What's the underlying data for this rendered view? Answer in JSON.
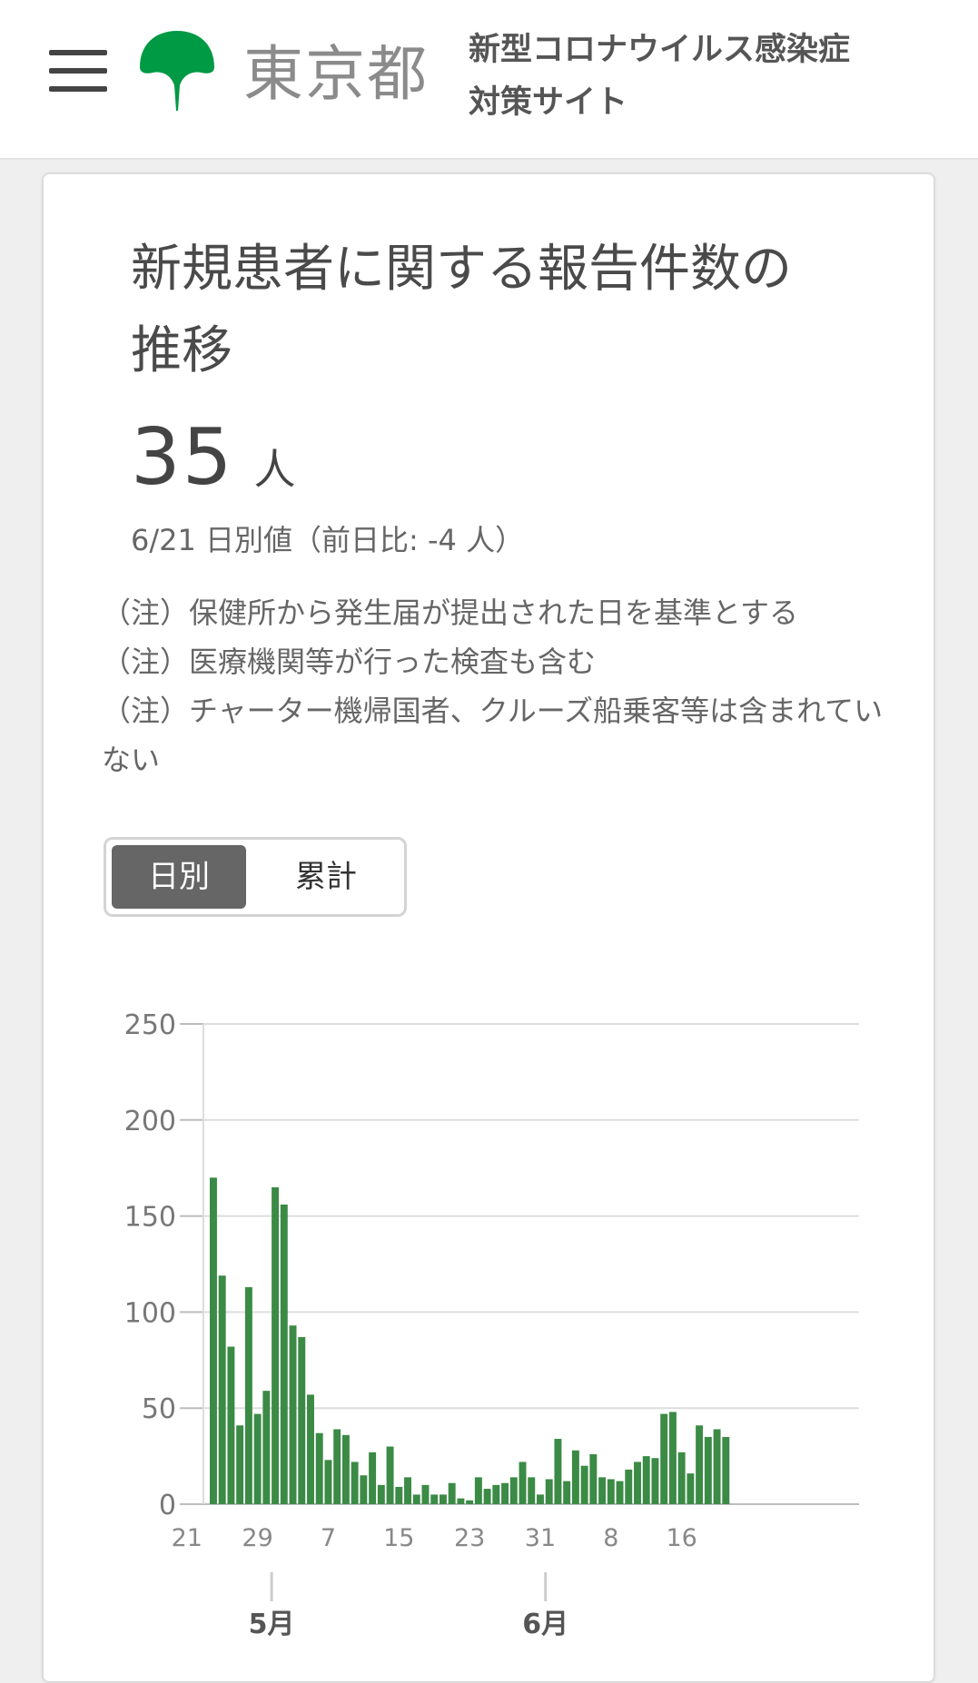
{
  "header": {
    "logo_text": "東京都",
    "site_title_line1": "新型コロナウイルス感染症",
    "site_title_line2": "対策サイト",
    "brand_color": "#009944"
  },
  "card": {
    "title_line1": "新規患者に関する報告件数の",
    "title_line2": "推移",
    "value": "35",
    "unit": "人",
    "subvalue": "6/21 日別値（前日比: -4 人）",
    "notes": [
      "（注）保健所から発生届が提出された日を基準とする",
      "（注）医療機関等が行った検査も含む",
      "（注）チャーター機帰国者、クルーズ船乗客等は含まれていない"
    ],
    "toggle": {
      "daily": "日別",
      "cumulative": "累計"
    }
  },
  "chart_data": {
    "type": "bar",
    "bar_color": "#3b8a45",
    "x_start": "2020-04-24",
    "x_end": "2020-06-21",
    "ylim": [
      0,
      250
    ],
    "y_ticks": [
      0,
      50,
      100,
      150,
      200,
      250
    ],
    "x_tick_labels": [
      "21",
      "29",
      "7",
      "15",
      "23",
      "31",
      "8",
      "16"
    ],
    "month_labels": [
      "5月",
      "6月"
    ],
    "values": [
      170,
      119,
      82,
      41,
      113,
      47,
      59,
      165,
      156,
      93,
      87,
      57,
      37,
      23,
      39,
      36,
      22,
      15,
      27,
      10,
      30,
      9,
      14,
      5,
      10,
      5,
      5,
      11,
      3,
      2,
      14,
      8,
      10,
      11,
      14,
      22,
      14,
      5,
      13,
      34,
      12,
      28,
      20,
      26,
      14,
      13,
      12,
      18,
      22,
      25,
      24,
      47,
      48,
      27,
      16,
      41,
      35,
      39,
      35
    ]
  }
}
